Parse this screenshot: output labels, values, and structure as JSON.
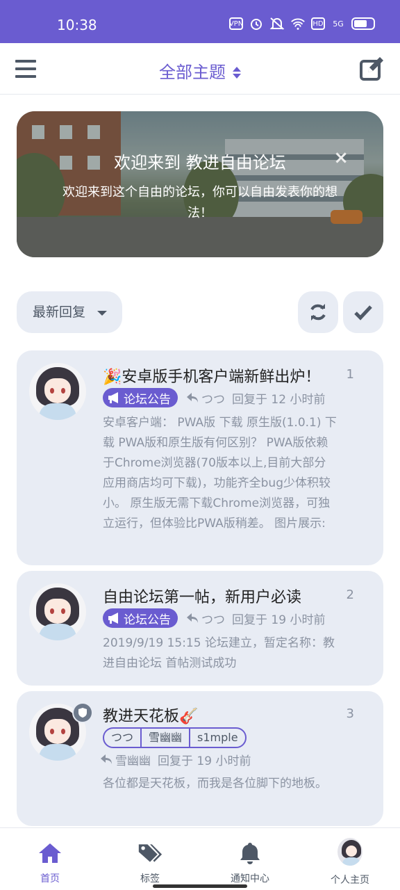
{
  "status": {
    "time": "10:38",
    "icons": [
      "vpn-icon",
      "alarm-icon",
      "mute-icon",
      "wifi-icon",
      "hd-icon",
      "5g-signal-icon",
      "battery-icon"
    ],
    "vpn_label": "VPN",
    "hd_label": "HD",
    "network_label": "5G"
  },
  "header": {
    "title": "全部主题",
    "colors": {
      "accent": "#6a5cd0",
      "icon": "#4e5866"
    }
  },
  "banner": {
    "title": "欢迎来到 教进自由论坛",
    "text": "欢迎来到这个自由的论坛，你可以自由发表你的想法！",
    "close": "×"
  },
  "toolbar": {
    "sort_label": "最新回复"
  },
  "posts": [
    {
      "title": "🎉安卓版手机客户端新鲜出炉！",
      "number": "1",
      "tag": "论坛公告",
      "reply_author": "つつ",
      "reply_text": "回复于 12 小时前",
      "excerpt": "安卓客户端： PWA版 下载 原生版(1.0.1) 下载 PWA版和原生版有何区别？ PWA版依赖于Chrome浏览器(70版本以上,目前大部分应用商店均可下载)，功能齐全bug少体积较小。 原生版无需下载Chrome浏览器，可独立运行，但体验比PWA版稍差。 图片展示:"
    },
    {
      "title": "自由论坛第一帖，新用户必读",
      "number": "2",
      "tag": "论坛公告",
      "reply_author": "つつ",
      "reply_text": "回复于 19 小时前",
      "excerpt": "2019/9/19 15:15 论坛建立，暂定名称：教进自由论坛 首帖测试成功"
    },
    {
      "title": "教进天花板🎸",
      "number": "3",
      "tags": [
        "つつ",
        "雪幽幽",
        "s1mple"
      ],
      "reply_author": "雪幽幽",
      "reply_text": "回复于 19 小时前",
      "excerpt": "各位都是天花板，而我是各位脚下的地板。"
    }
  ],
  "nav": {
    "home": "首页",
    "tags": "标签",
    "notifications": "通知中心",
    "profile": "个人主页"
  }
}
